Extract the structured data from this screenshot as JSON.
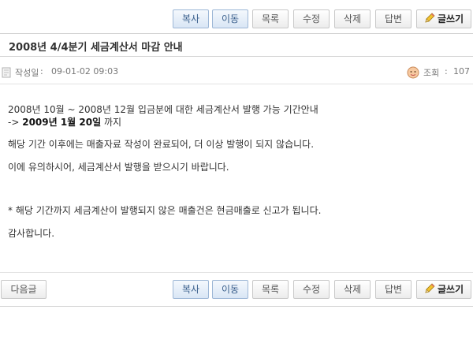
{
  "toolbar": {
    "copy": "복사",
    "move": "이동",
    "list": "목록",
    "edit": "수정",
    "delete": "삭제",
    "reply": "답변",
    "write": "글쓰기",
    "next": "다음글"
  },
  "post": {
    "title": "2008년 4/4분기 세금계산서 마감 안내",
    "date_label": "작성일",
    "date": "09-01-02 09:03",
    "views_label": "조회",
    "views": "107",
    "separator": ":"
  },
  "content": {
    "line1": "2008년 10월 ~ 2008년 12월 입금분에 대한 세금계산서 발행 가능 기간안내",
    "line2_prefix": "->",
    "line2_highlight": "2009년 1월 20일",
    "line2_suffix": "까지",
    "line3": "해당 기간 이후에는 매출자료 작성이 완료되어, 더 이상 발행이 되지 않습니다.",
    "line4": "이에 유의하시어, 세금계산서 발행을 받으시기 바랍니다.",
    "line5": "* 해당 기간까지 세금계산이 발행되지 않은 매출건은 현금매출로 신고가 됩니다.",
    "line6": "감사합니다."
  },
  "colors": {
    "accent_blue": "#3a5f8c",
    "border": "#c8c8c8"
  }
}
